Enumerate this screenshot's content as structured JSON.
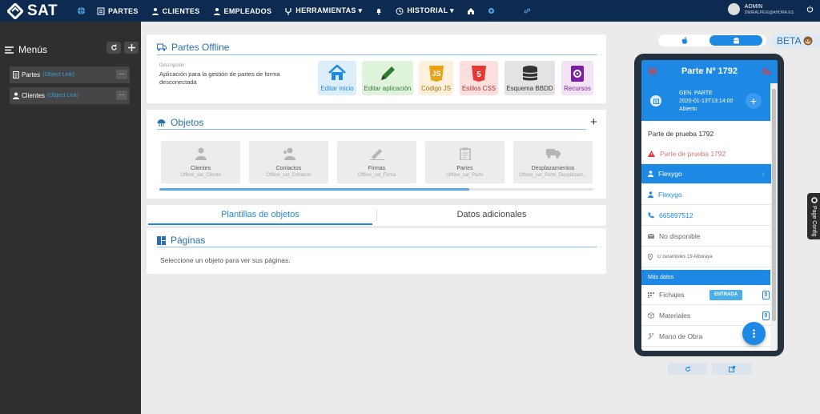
{
  "topbar": {
    "logo_text": "SAT",
    "nav": [
      {
        "label": "PARTES",
        "icon": "list-icon"
      },
      {
        "label": "CLIENTES",
        "icon": "user-icon"
      },
      {
        "label": "EMPLEADOS",
        "icon": "user-tie-icon"
      },
      {
        "label": "HERRAMIENTAS ▾",
        "icon": "tools-icon"
      },
      {
        "label": "",
        "icon": "bell-icon"
      },
      {
        "label": "HISTORIAL ▾",
        "icon": "history-icon"
      },
      {
        "label": "",
        "icon": "home-icon"
      }
    ],
    "user_name": "ADMIN",
    "user_email": "DMIRALPEIX@AHORA.ES"
  },
  "sidebar": {
    "title": "Menús",
    "items": [
      {
        "label": "Partes",
        "link": "(Object Link)"
      },
      {
        "label": "Clientes",
        "link": "(Object Link)"
      }
    ]
  },
  "app_card": {
    "title": "Partes Offline",
    "desc_label": "Descripción",
    "desc_text": "Aplicación para la gestión de partes de forma desconectada",
    "tiles": [
      {
        "label": "Editar inicio",
        "bg": "#dbeefa",
        "color": "#1e88e5"
      },
      {
        "label": "Editar aplicación",
        "bg": "#dff3dd",
        "color": "#2e7d32"
      },
      {
        "label": "Código JS",
        "bg": "#fdf0dc",
        "color": "#b06f00"
      },
      {
        "label": "Estilos CSS",
        "bg": "#fbe0de",
        "color": "#c62828"
      },
      {
        "label": "Esquema BBDD",
        "bg": "#e3e3e3",
        "color": "#333333"
      },
      {
        "label": "Recursos",
        "bg": "#f3e3f4",
        "color": "#7b1fa2"
      }
    ]
  },
  "objects_card": {
    "title": "Objetos",
    "add": "+",
    "items": [
      {
        "title": "Clientes",
        "sub": "Offline_sat_Cliente"
      },
      {
        "title": "Contactos",
        "sub": "Offline_sat_Contacto"
      },
      {
        "title": "Firmas",
        "sub": "Offline_sat_Firma"
      },
      {
        "title": "Partes",
        "sub": "Offline_sat_Parte"
      },
      {
        "title": "Desplazamientos",
        "sub": "Offline_sat_Parte_Desplazam..."
      }
    ]
  },
  "tabs": {
    "left": "Plantillas de objetos",
    "right": "Datos adicionales"
  },
  "pages_card": {
    "title": "Páginas",
    "empty": "Seleccione un objeto para ver sus páginas."
  },
  "preview": {
    "beta": "BETA",
    "page_config": "Page Config",
    "header_title": "Parte Nº 1792",
    "gen_label": "GEN. PARTE",
    "gen_date": "2020-01-13T13:14:00",
    "gen_status": "Abierto",
    "desc": "Parte de prueba 1792",
    "warning": "Parte de prueba 1792",
    "client_selected": "Flexygo",
    "contact": "Flexygo",
    "phone": "665897512",
    "email": "No disponible",
    "address": "c/ ceramistes 19 Alboraya",
    "more_data": "Más datos",
    "fichajes": "Fichajes",
    "entrada": "ENTRADA",
    "fichajes_count": "0",
    "materiales": "Materiales",
    "materiales_count": "0",
    "mano_obra": "Mano de Obra"
  },
  "colors": {
    "accent": "#1e88e5",
    "topbar": "#0d2b50",
    "sidebar": "#2f2f2f"
  }
}
